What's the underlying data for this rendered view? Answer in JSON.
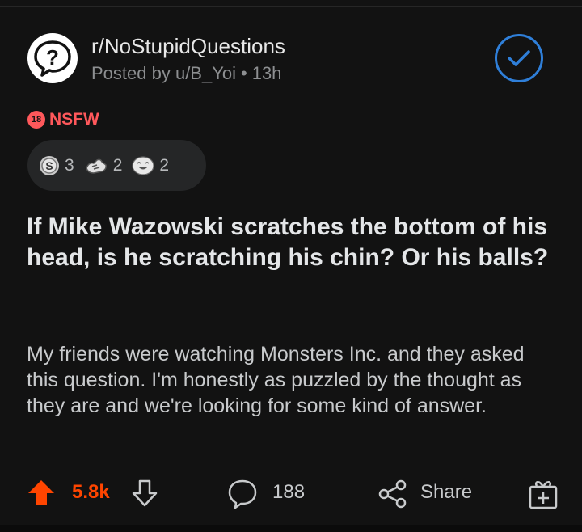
{
  "post": {
    "subreddit": "r/NoStupidQuestions",
    "posted_by": "Posted by u/B_Yoi",
    "dot": "•",
    "age": "13h",
    "nsfw_badge": "18",
    "nsfw_label": "NSFW",
    "awards": [
      {
        "icon": "silver-award-icon",
        "count": "3"
      },
      {
        "icon": "wholesome-seal-award-icon",
        "count": "2"
      },
      {
        "icon": "laughing-award-icon",
        "count": "2"
      }
    ],
    "title": "If Mike Wazowski scratches the bottom of his head, is he scratching his chin? Or his balls?",
    "body": "My friends were watching Monsters Inc. and they asked this question. I'm honestly as puzzled by the thought as they are and we're looking for some kind of answer."
  },
  "actions": {
    "score": "5.8k",
    "comments": "188",
    "share_label": "Share"
  },
  "colors": {
    "background": "#121212",
    "upvote": "#ff4500",
    "nsfw": "#ff585b",
    "joined": "#2f7fd9"
  }
}
